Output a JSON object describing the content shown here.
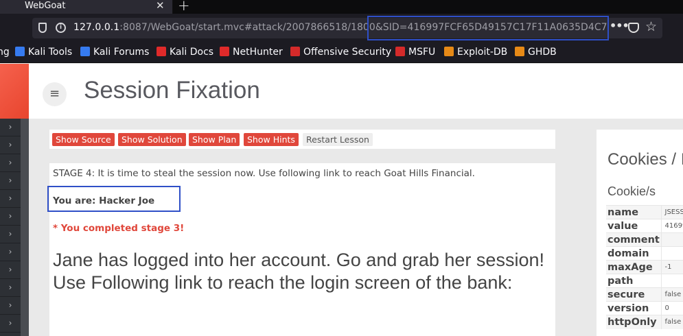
{
  "browser": {
    "tab_title": "WebGoat",
    "url_host": "127.0.0.1",
    "url_rest": ":8087/WebGoat/start.mvc#attack/2007866518/1800&SID=416997FCF65D49157C17F11A0635D4C7",
    "bookmarks": [
      {
        "label": "ng",
        "icon": "bookmark-icon",
        "color": "#1c1b22"
      },
      {
        "label": "Kali Tools",
        "icon": "kali-icon",
        "color": "#367bf0"
      },
      {
        "label": "Kali Forums",
        "icon": "kali-icon",
        "color": "#367bf0"
      },
      {
        "label": "Kali Docs",
        "icon": "kali-docs-icon",
        "color": "#e02a2a"
      },
      {
        "label": "NetHunter",
        "icon": "nethunter-icon",
        "color": "#e02a2a"
      },
      {
        "label": "Offensive Security",
        "icon": "offsec-icon",
        "color": "#d42a2a"
      },
      {
        "label": "MSFU",
        "icon": "msfu-icon",
        "color": "#d42a2a"
      },
      {
        "label": "Exploit-DB",
        "icon": "exploit-db-icon",
        "color": "#e78a17"
      },
      {
        "label": "GHDB",
        "icon": "ghdb-icon",
        "color": "#e78a17"
      }
    ]
  },
  "page": {
    "title": "Session Fixation",
    "buttons": [
      "Show Source",
      "Show Solution",
      "Show Plan",
      "Show Hints",
      "Restart Lesson"
    ],
    "stage_text": "STAGE 4: It is time to steal the session now. Use following link to reach Goat Hills Financial.",
    "you_are": "You are: Hacker Joe",
    "completed": "* You completed stage 3!",
    "message": "Jane has logged into her account. Go and grab her session! Use Following link to reach the login screen of the bank:"
  },
  "cookies": {
    "title": "Cookies / I",
    "subtitle": "Cookie/s",
    "rows": [
      {
        "key": "name",
        "value": "JSESS"
      },
      {
        "key": "value",
        "value": "41699"
      },
      {
        "key": "comment",
        "value": ""
      },
      {
        "key": "domain",
        "value": ""
      },
      {
        "key": "maxAge",
        "value": "-1"
      },
      {
        "key": "path",
        "value": ""
      },
      {
        "key": "secure",
        "value": "false"
      },
      {
        "key": "version",
        "value": "0"
      },
      {
        "key": "httpOnly",
        "value": "false"
      }
    ]
  },
  "colors": {
    "accent_red": "#e0473b",
    "annotation_blue": "#2f4fc7"
  }
}
